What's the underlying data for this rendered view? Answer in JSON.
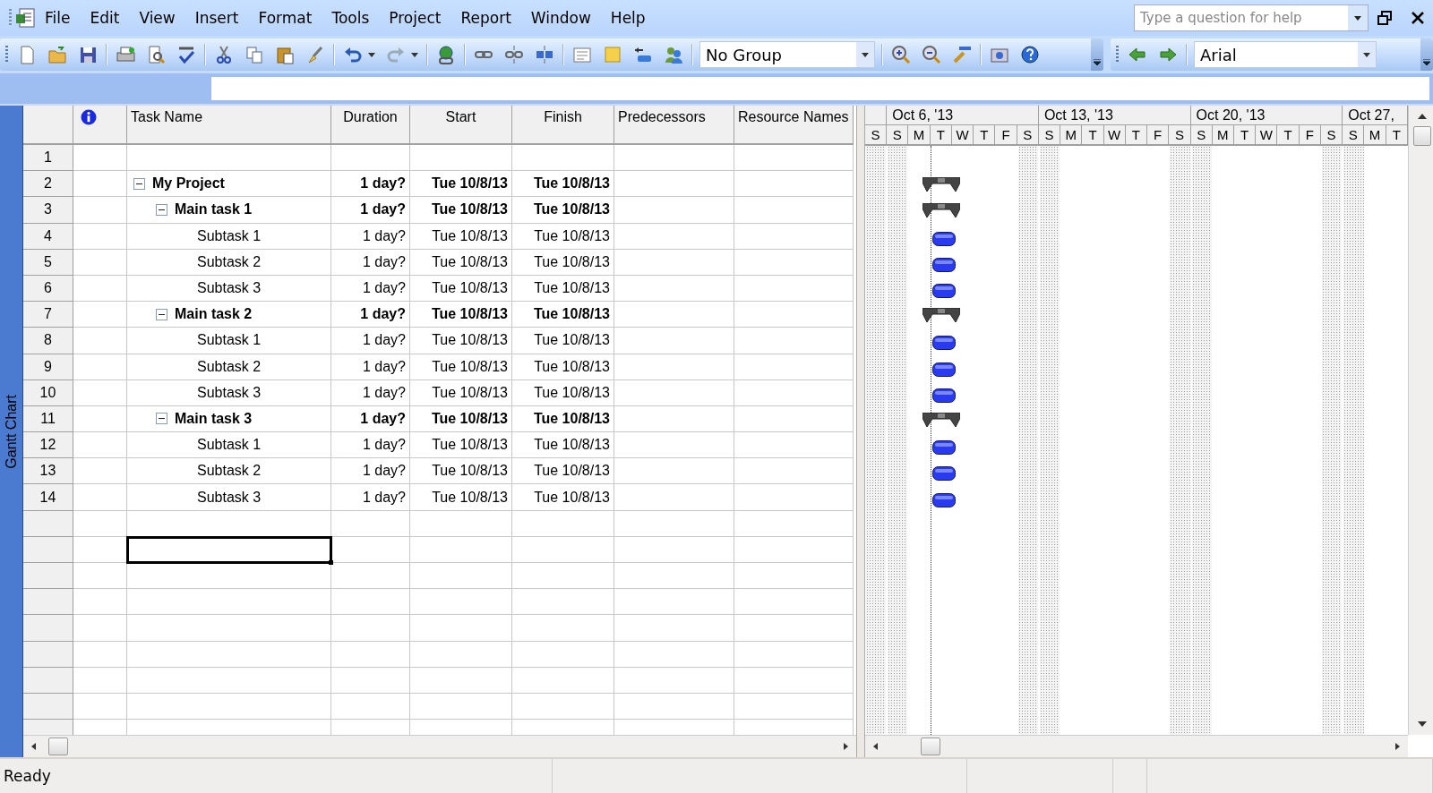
{
  "menu_bar": {
    "items": [
      {
        "label": "File"
      },
      {
        "label": "Edit"
      },
      {
        "label": "View"
      },
      {
        "label": "Insert"
      },
      {
        "label": "Format"
      },
      {
        "label": "Tools"
      },
      {
        "label": "Project"
      },
      {
        "label": "Report"
      },
      {
        "label": "Window"
      },
      {
        "label": "Help"
      }
    ],
    "help_search": {
      "placeholder": "Type a question for help"
    }
  },
  "toolbar": {
    "group_select": {
      "value": "No Group"
    },
    "font_select": {
      "value": "Arial"
    }
  },
  "view_bar": {
    "label": "Gantt Chart"
  },
  "table": {
    "columns": [
      {
        "label": "Task Name"
      },
      {
        "label": "Duration"
      },
      {
        "label": "Start"
      },
      {
        "label": "Finish"
      },
      {
        "label": "Predecessors"
      },
      {
        "label": "Resource Names"
      }
    ],
    "tasks": [
      {
        "row_number": "1",
        "kind": "empty"
      },
      {
        "row_number": "2",
        "kind": "summary",
        "name": "My Project",
        "expanded": true,
        "duration": "1 day?",
        "start": "Tue 10/8/13",
        "finish": "Tue 10/8/13",
        "children": [
          {
            "row_number": "3",
            "kind": "summary",
            "name": "Main task 1",
            "expanded": true,
            "duration": "1 day?",
            "start": "Tue 10/8/13",
            "finish": "Tue 10/8/13",
            "children": [
              {
                "row_number": "4",
                "kind": "task",
                "name": "Subtask 1",
                "duration": "1 day?",
                "start": "Tue 10/8/13",
                "finish": "Tue 10/8/13"
              },
              {
                "row_number": "5",
                "kind": "task",
                "name": "Subtask 2",
                "duration": "1 day?",
                "start": "Tue 10/8/13",
                "finish": "Tue 10/8/13"
              },
              {
                "row_number": "6",
                "kind": "task",
                "name": "Subtask 3",
                "duration": "1 day?",
                "start": "Tue 10/8/13",
                "finish": "Tue 10/8/13"
              }
            ]
          },
          {
            "row_number": "7",
            "kind": "summary",
            "name": "Main task 2",
            "expanded": true,
            "duration": "1 day?",
            "start": "Tue 10/8/13",
            "finish": "Tue 10/8/13",
            "children": [
              {
                "row_number": "8",
                "kind": "task",
                "name": "Subtask 1",
                "duration": "1 day?",
                "start": "Tue 10/8/13",
                "finish": "Tue 10/8/13"
              },
              {
                "row_number": "9",
                "kind": "task",
                "name": "Subtask 2",
                "duration": "1 day?",
                "start": "Tue 10/8/13",
                "finish": "Tue 10/8/13"
              },
              {
                "row_number": "10",
                "kind": "task",
                "name": "Subtask 3",
                "duration": "1 day?",
                "start": "Tue 10/8/13",
                "finish": "Tue 10/8/13"
              }
            ]
          },
          {
            "row_number": "11",
            "kind": "summary",
            "name": "Main task 3",
            "expanded": true,
            "duration": "1 day?",
            "start": "Tue 10/8/13",
            "finish": "Tue 10/8/13",
            "children": [
              {
                "row_number": "12",
                "kind": "task",
                "name": "Subtask 1",
                "duration": "1 day?",
                "start": "Tue 10/8/13",
                "finish": "Tue 10/8/13"
              },
              {
                "row_number": "13",
                "kind": "task",
                "name": "Subtask 2",
                "duration": "1 day?",
                "start": "Tue 10/8/13",
                "finish": "Tue 10/8/13"
              },
              {
                "row_number": "14",
                "kind": "task",
                "name": "Subtask 3",
                "duration": "1 day?",
                "start": "Tue 10/8/13",
                "finish": "Tue 10/8/13"
              }
            ]
          }
        ]
      }
    ],
    "blank_rows": [
      {
        "active_cell": false
      },
      {
        "active_cell": true
      },
      {
        "active_cell": false
      },
      {
        "active_cell": false
      },
      {
        "active_cell": false
      },
      {
        "active_cell": false
      },
      {
        "active_cell": false
      },
      {
        "active_cell": false
      },
      {
        "active_cell": false
      }
    ]
  },
  "timescale": {
    "weeks": [
      {
        "label": "Oct 6, '13"
      },
      {
        "label": "Oct 13, '13"
      },
      {
        "label": "Oct 20, '13"
      },
      {
        "label": "Oct 27,"
      }
    ],
    "days": [
      {
        "letter": "S",
        "nonworking": true,
        "today": false
      },
      {
        "letter": "S",
        "nonworking": true,
        "today": false
      },
      {
        "letter": "M",
        "nonworking": false,
        "today": false
      },
      {
        "letter": "T",
        "nonworking": false,
        "today": true
      },
      {
        "letter": "W",
        "nonworking": false,
        "today": false
      },
      {
        "letter": "T",
        "nonworking": false,
        "today": false
      },
      {
        "letter": "F",
        "nonworking": false,
        "today": false
      },
      {
        "letter": "S",
        "nonworking": true,
        "today": false
      },
      {
        "letter": "S",
        "nonworking": true,
        "today": false
      },
      {
        "letter": "M",
        "nonworking": false,
        "today": false
      },
      {
        "letter": "T",
        "nonworking": false,
        "today": false
      },
      {
        "letter": "W",
        "nonworking": false,
        "today": false
      },
      {
        "letter": "T",
        "nonworking": false,
        "today": false
      },
      {
        "letter": "F",
        "nonworking": false,
        "today": false
      },
      {
        "letter": "S",
        "nonworking": true,
        "today": false
      },
      {
        "letter": "S",
        "nonworking": true,
        "today": false
      },
      {
        "letter": "M",
        "nonworking": false,
        "today": false
      },
      {
        "letter": "T",
        "nonworking": false,
        "today": false
      },
      {
        "letter": "W",
        "nonworking": false,
        "today": false
      },
      {
        "letter": "T",
        "nonworking": false,
        "today": false
      },
      {
        "letter": "F",
        "nonworking": false,
        "today": false
      },
      {
        "letter": "S",
        "nonworking": true,
        "today": false
      },
      {
        "letter": "S",
        "nonworking": true,
        "today": false
      },
      {
        "letter": "M",
        "nonworking": false,
        "today": false
      },
      {
        "letter": "T",
        "nonworking": false,
        "today": false
      }
    ]
  },
  "status_bar": {
    "text": "Ready"
  }
}
